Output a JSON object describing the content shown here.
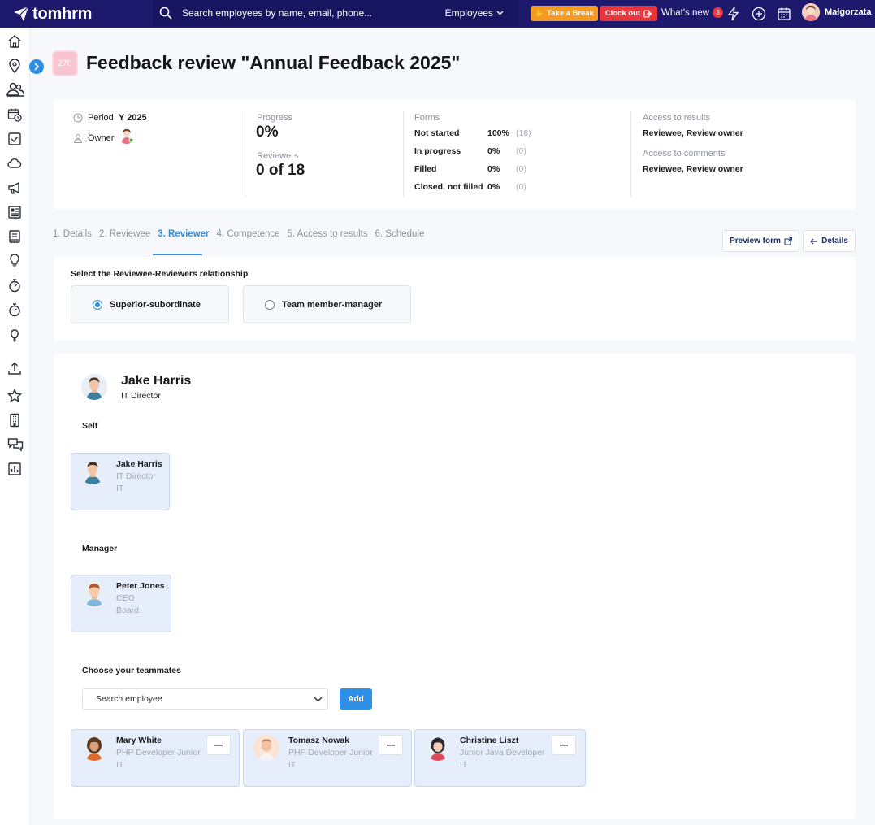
{
  "brand": {
    "name": "tomhrm"
  },
  "topbar": {
    "search_placeholder": "Search employees by name, email, phone...",
    "search_scope": "Employees",
    "take_break": "Take a Break",
    "clock_out": "Clock out",
    "whats_new": "What's new",
    "whats_new_count": "3",
    "user_name": "Małgorzata",
    "colors": {
      "bar": "#1d1a6e",
      "break": "#f59a24",
      "clock_out": "#e6373f"
    }
  },
  "sidebar": {
    "icons": [
      "home-icon",
      "location-pin-icon",
      "people-icon",
      "calendar-clock-icon",
      "checkbox-icon",
      "cloud-icon",
      "megaphone-icon",
      "news-icon",
      "book-icon",
      "lightbulb-icon",
      "stopwatch-icon",
      "stopwatch-icon",
      "balloon-icon",
      "upload-icon",
      "star-icon",
      "building-icon",
      "chat-icon",
      "report-icon"
    ]
  },
  "page": {
    "badge": "270",
    "title": "Feedback review \"Annual Feedback 2025\""
  },
  "summary": {
    "period_label": "Period",
    "period_value": "Y 2025",
    "owner_label": "Owner",
    "progress_label": "Progress",
    "progress_value": "0%",
    "reviewers_label": "Reviewers",
    "reviewers_value": "0 of 18",
    "forms_label": "Forms",
    "forms": [
      {
        "label": "Not started",
        "pct": "100%",
        "count": "(18)"
      },
      {
        "label": "In progress",
        "pct": "0%",
        "count": "(0)"
      },
      {
        "label": "Filled",
        "pct": "0%",
        "count": "(0)"
      },
      {
        "label": "Closed, not filled",
        "pct": "0%",
        "count": "(0)"
      }
    ],
    "access_results_label": "Access to results",
    "access_results_value": "Reviewee, Review owner",
    "access_comments_label": "Access to comments",
    "access_comments_value": "Reviewee, Review owner"
  },
  "tabs": [
    {
      "label": "1. Details"
    },
    {
      "label": "2. Reviewee"
    },
    {
      "label": "3. Reviewer",
      "active": true
    },
    {
      "label": "4. Competence"
    },
    {
      "label": "5. Access to results"
    },
    {
      "label": "6. Schedule"
    }
  ],
  "actions": {
    "preview_form": "Preview form",
    "details": "Details"
  },
  "relationship": {
    "label": "Select the Reviewee-Reviewers relationship",
    "options": [
      {
        "label": "Superior-subordinate",
        "selected": true
      },
      {
        "label": "Team member-manager",
        "selected": false
      }
    ]
  },
  "reviewee": {
    "name": "Jake Harris",
    "role": "IT Director"
  },
  "self": {
    "label": "Self",
    "person": {
      "name": "Jake Harris",
      "role": "IT Director",
      "dept": "IT"
    }
  },
  "manager": {
    "label": "Manager",
    "person": {
      "name": "Peter Jones",
      "role": "CEO",
      "dept": "Board"
    }
  },
  "teammates": {
    "label": "Choose your teammates",
    "search_placeholder": "Search employee",
    "add_label": "Add",
    "people": [
      {
        "name": "Mary White",
        "role": "PHP Developer Junior",
        "dept": "IT"
      },
      {
        "name": "Tomasz Nowak",
        "role": "PHP Developer Junior",
        "dept": "IT"
      },
      {
        "name": "Christine Liszt",
        "role": "Junior Java Developer",
        "dept": "IT"
      }
    ]
  }
}
